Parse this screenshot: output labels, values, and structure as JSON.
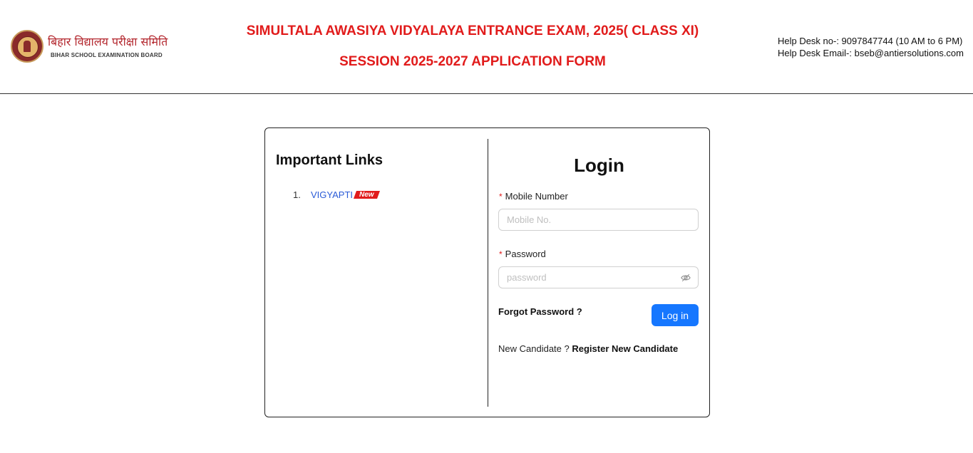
{
  "header": {
    "logo": {
      "hindi_name": "बिहार विद्यालय परीक्षा समिति",
      "english_name": "BIHAR SCHOOL EXAMINATION BOARD",
      "seal_icon": "bseb-seal-icon"
    },
    "title_line1": "SIMULTALA AWASIYA VIDYALAYA ENTRANCE EXAM, 2025( CLASS XI)",
    "title_line2": "SESSION 2025-2027 APPLICATION FORM",
    "helpdesk_phone": "Help Desk no-: 9097847744 (10 AM to 6 PM)",
    "helpdesk_email": "Help Desk Email-: bseb@antiersolutions.com"
  },
  "links": {
    "title": "Important Links",
    "items": [
      {
        "number": "1.",
        "label": "VIGYAPTI",
        "badge": "New"
      }
    ]
  },
  "login": {
    "title": "Login",
    "required_marker": "*",
    "mobile_label": "Mobile Number",
    "mobile_placeholder": "Mobile No.",
    "mobile_value": "",
    "password_label": "Password",
    "password_placeholder": "password",
    "password_value": "",
    "password_toggle_icon": "eye-slash-icon",
    "forgot_label": "Forgot Password ?",
    "login_button": "Log in",
    "new_candidate_text": "New Candidate ?",
    "register_label": "Register New Candidate"
  },
  "colors": {
    "title_red": "#e11b1b",
    "link_blue": "#2a5bd7",
    "primary_button": "#1677ff",
    "badge_red": "#e11b1b"
  }
}
